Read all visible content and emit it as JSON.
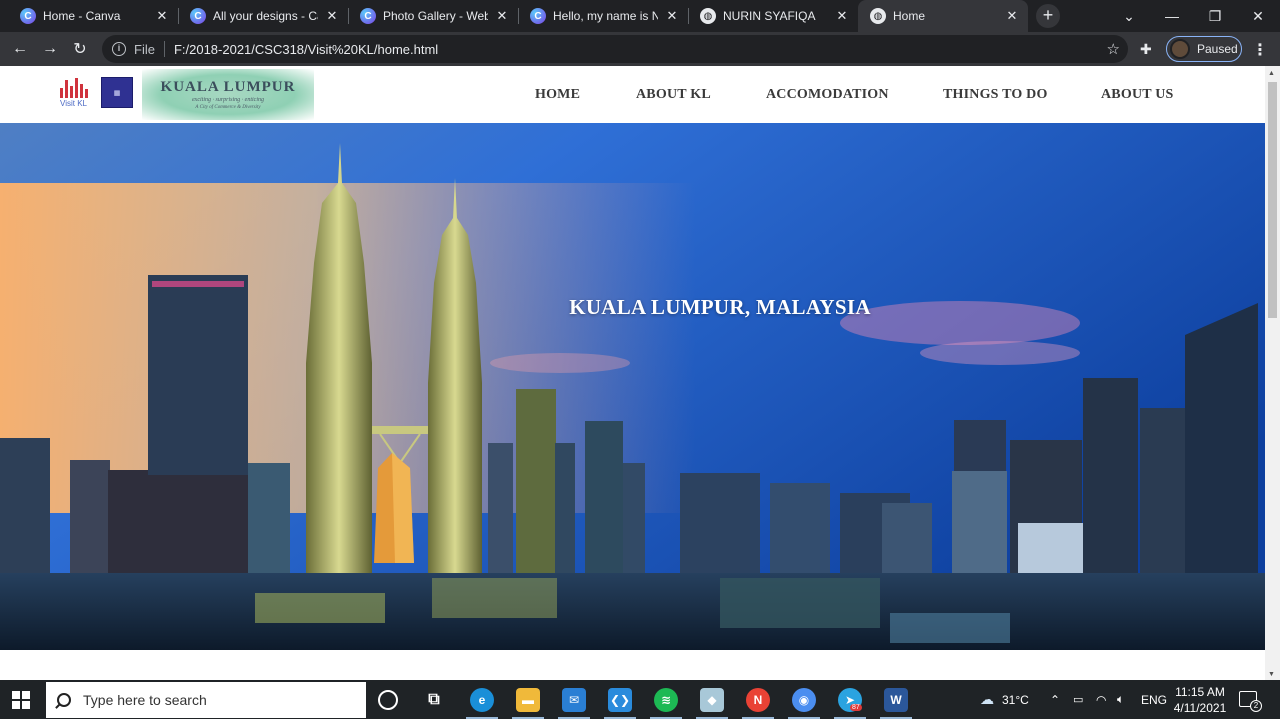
{
  "browser": {
    "tabs": [
      {
        "title": "Home - Canva",
        "icon": "canva-icon",
        "active": false
      },
      {
        "title": "All your designs - Can",
        "icon": "canva-icon",
        "active": false
      },
      {
        "title": "Photo Gallery - Websi",
        "icon": "canva-icon",
        "active": false
      },
      {
        "title": "Hello, my name is Nur",
        "icon": "canva-icon",
        "active": false
      },
      {
        "title": "NURIN SYAFIQA",
        "icon": "globe-icon",
        "active": false
      },
      {
        "title": "Home",
        "icon": "globe-icon",
        "active": true
      }
    ],
    "address": {
      "scheme": "File",
      "url": "F:/2018-2021/CSC318/Visit%20KL/home.html"
    },
    "profile_status": "Paused"
  },
  "site": {
    "logos": {
      "visitkl_label": "Visit KL",
      "kl_title": "KUALA LUMPUR",
      "kl_tagline": "exciting · surprising · enticing",
      "kl_sub": "A City of Commerce & Diversity"
    },
    "nav": [
      "HOME",
      "ABOUT KL",
      "ACCOMODATION",
      "THINGS TO DO",
      "ABOUT US"
    ],
    "hero_title": "KUALA LUMPUR, MALAYSIA"
  },
  "taskbar": {
    "search_placeholder": "Type here to search",
    "temperature": "31°C",
    "language": "ENG",
    "time": "11:15 AM",
    "date": "4/11/2021",
    "notification_count": "2",
    "telegram_badge": "87"
  },
  "colors": {
    "chrome_dark": "#202124",
    "chrome_toolbar": "#35363a",
    "taskbar": "#1f2326",
    "accent_blue": "#8ab4f8"
  }
}
